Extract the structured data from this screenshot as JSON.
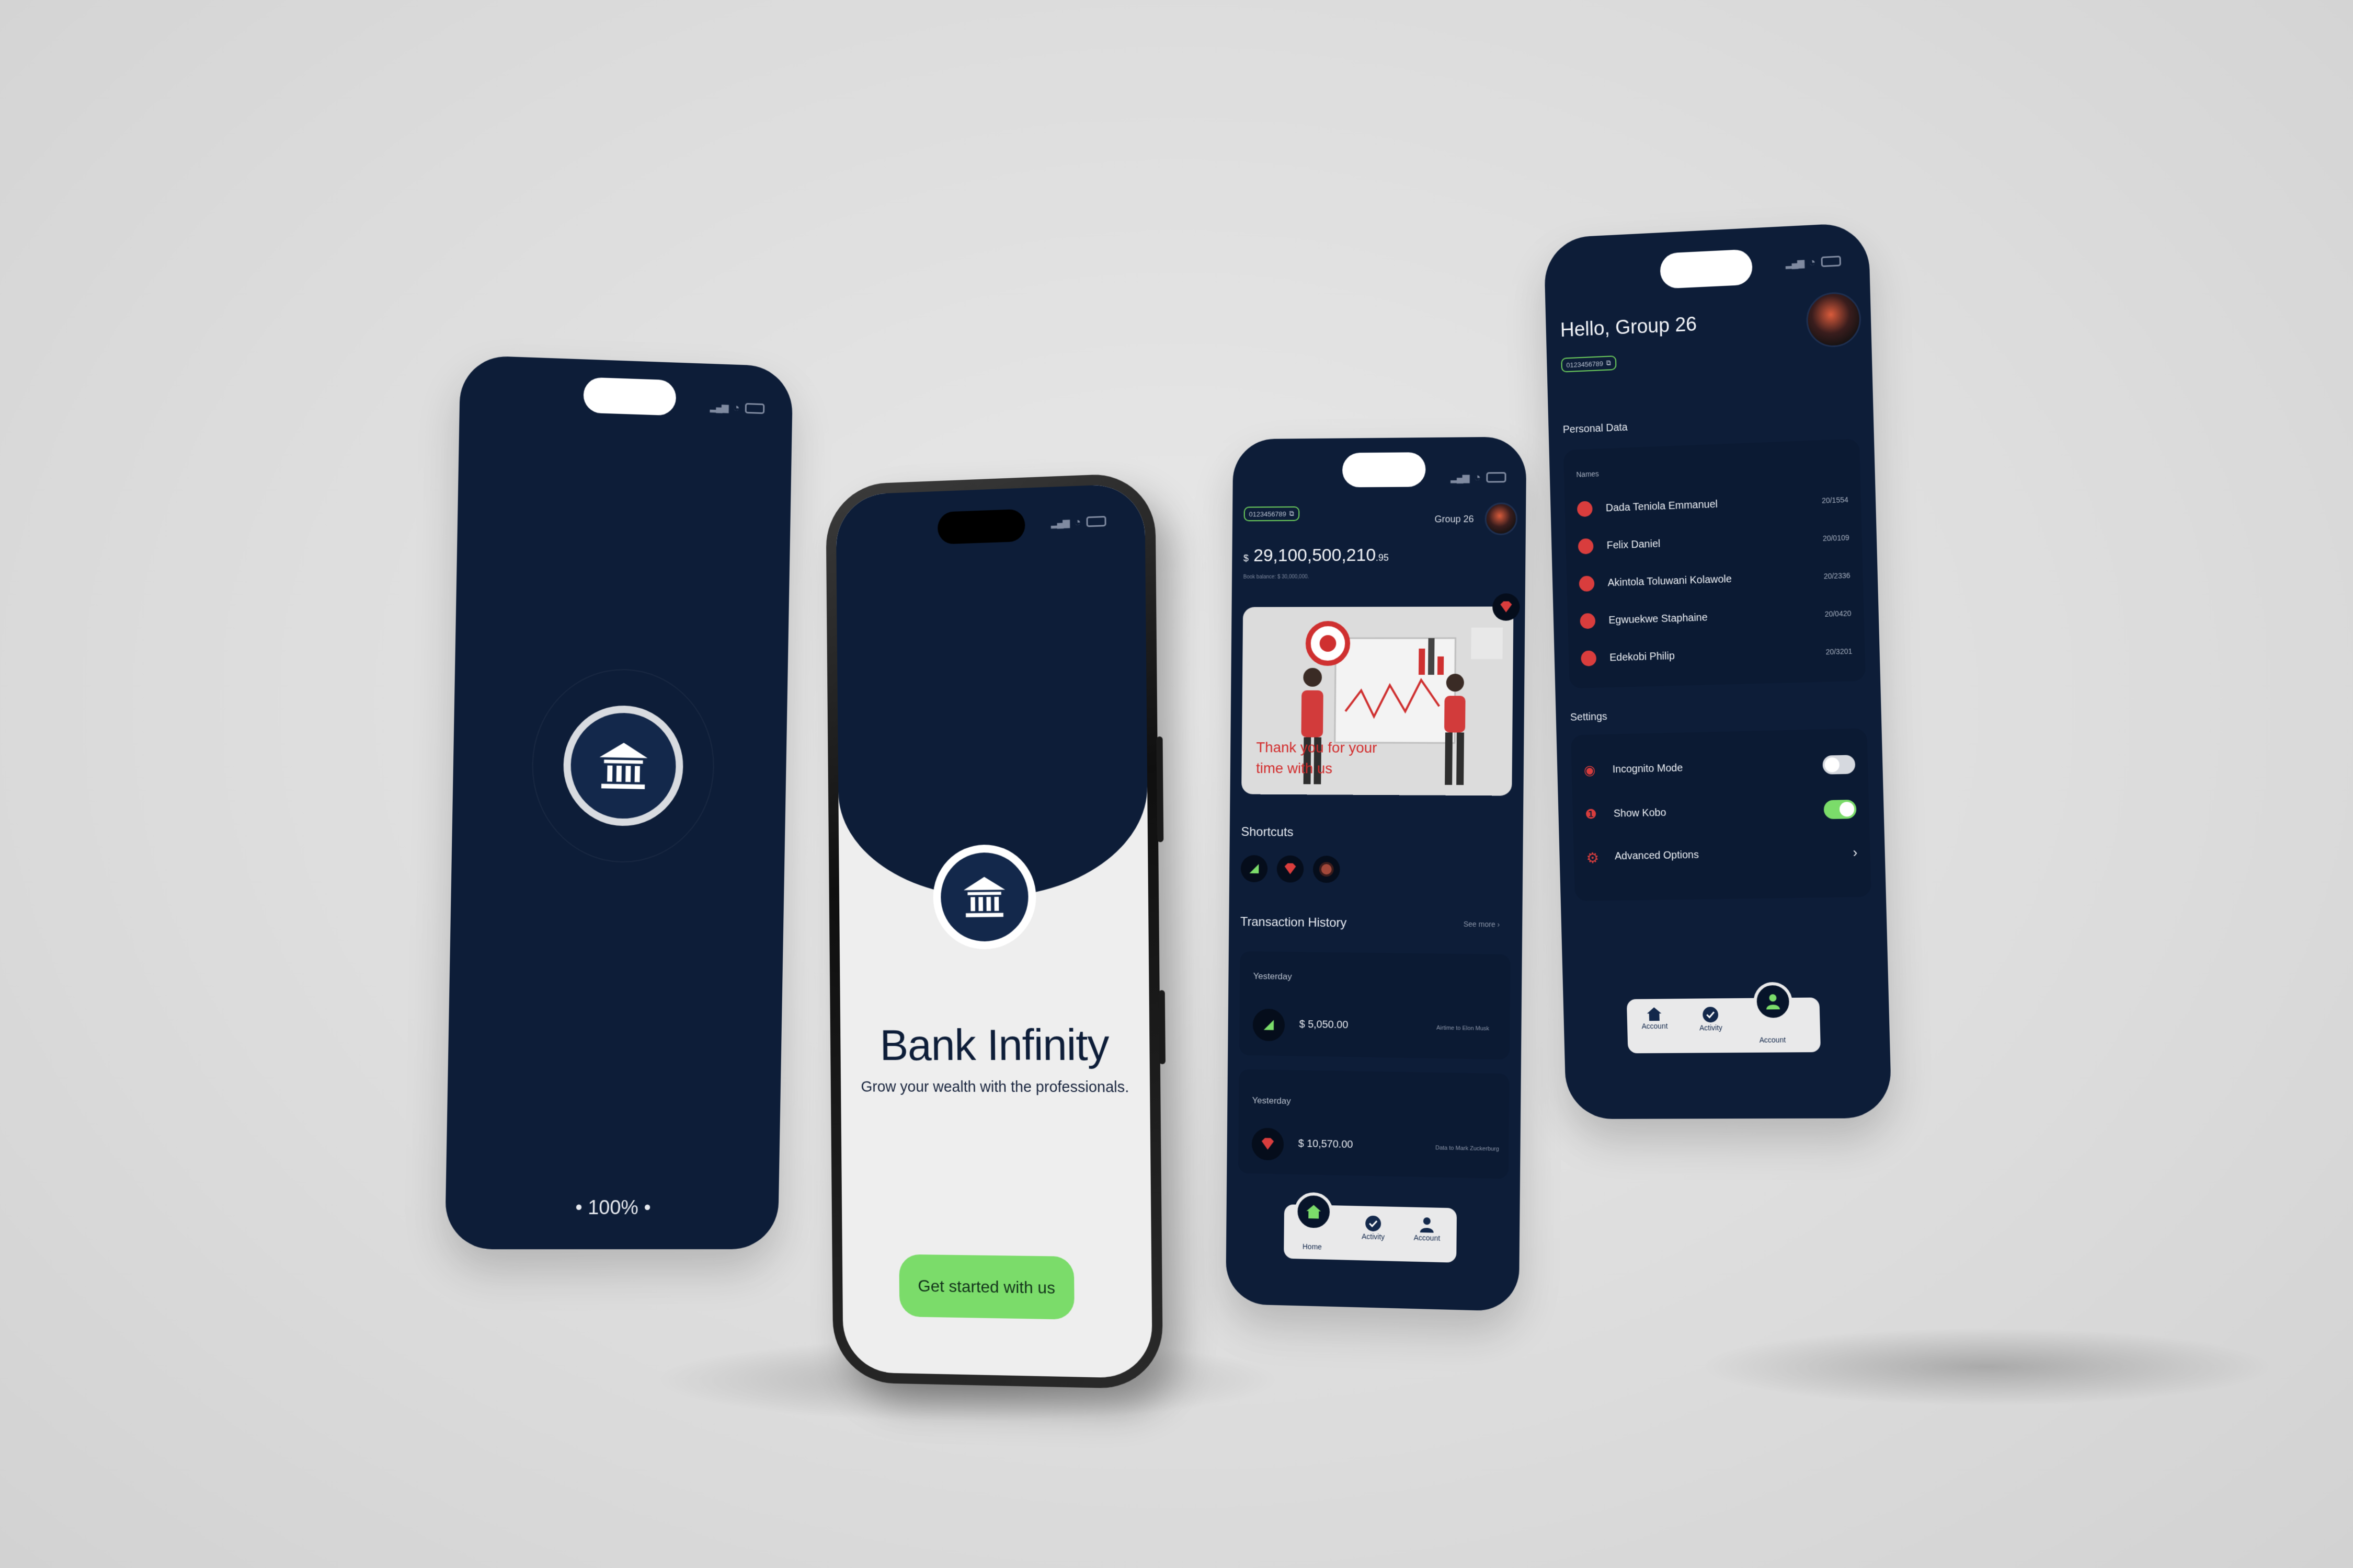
{
  "splash": {
    "progress_text": "• 100% •"
  },
  "welcome": {
    "title": "Bank Infinity",
    "subtitle": "Grow your wealth with the professionals.",
    "cta_label": "Get started with us"
  },
  "home": {
    "account_number": "0123456789",
    "group_name": "Group 26",
    "balance_currency": "$",
    "balance_main": "29,100,500,210",
    "balance_cents": ".95",
    "book_balance": "Book balance: $ 30,000,000.",
    "banner_text_line1": "Thank you for your",
    "banner_text_line2": "time with us",
    "shortcuts_title": "Shortcuts",
    "transaction_history_title": "Transaction History",
    "see_more_label": "See more ›",
    "transactions": [
      {
        "date": "Yesterday",
        "amount": "$ 5,050.00",
        "description": "Airtime to Elon Musk"
      },
      {
        "date": "Yesterday",
        "amount": "$ 10,570.00",
        "description": "Data to Mark Zuckerburg"
      }
    ],
    "nav": {
      "home": "Home",
      "activity": "Activity",
      "account": "Account"
    }
  },
  "account": {
    "greeting": "Hello, Group 26",
    "account_number": "0123456789",
    "personal_data_title": "Personal Data",
    "names_label": "Names",
    "members": [
      {
        "name": "Dada Teniola Emmanuel",
        "id": "20/1554"
      },
      {
        "name": "Felix Daniel",
        "id": "20/0109"
      },
      {
        "name": "Akintola Toluwani Kolawole",
        "id": "20/2336"
      },
      {
        "name": "Egwuekwe Staphaine",
        "id": "20/0420"
      },
      {
        "name": "Edekobi Philip",
        "id": "20/3201"
      }
    ],
    "settings_title": "Settings",
    "settings": [
      {
        "label": "Incognito Mode",
        "state": "off"
      },
      {
        "label": "Show Kobo",
        "state": "on"
      },
      {
        "label": "Advanced Options"
      }
    ],
    "nav": {
      "home": "Account",
      "activity": "Activity",
      "account": "Account"
    }
  },
  "colors": {
    "navy": "#0d1d38",
    "accent_green": "#7bdc6a",
    "alert_red": "#d93d3d",
    "card": "#0b1a33"
  }
}
